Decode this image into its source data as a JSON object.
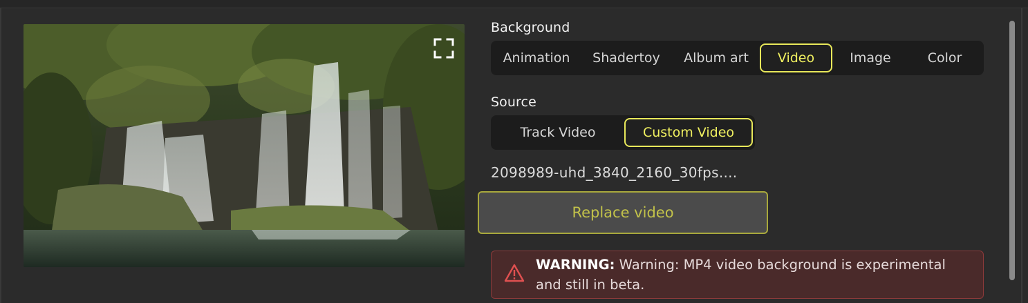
{
  "preview": {
    "image_description_icon": "waterfall-image",
    "fullscreen_icon": "fullscreen-icon"
  },
  "background": {
    "label": "Background",
    "options": [
      "Animation",
      "Shadertoy",
      "Album art",
      "Video",
      "Image",
      "Color"
    ],
    "selected": "Video"
  },
  "source": {
    "label": "Source",
    "options": [
      "Track Video",
      "Custom Video"
    ],
    "selected": "Custom Video"
  },
  "file": {
    "name": "2098989-uhd_3840_2160_30fps...."
  },
  "replace_button": {
    "label": "Replace video"
  },
  "warning": {
    "prefix": "WARNING:",
    "message": "Warning: MP4 video background is experimental and still in beta.",
    "icon": "warning-icon"
  },
  "colors": {
    "accent": "#e8e85a",
    "panel": "#2b2b2b",
    "segment_bg": "#1c1c1c",
    "warning_bg": "#4a2a2a",
    "warning_border": "#8b3a3a",
    "warning_icon": "#e05050"
  }
}
